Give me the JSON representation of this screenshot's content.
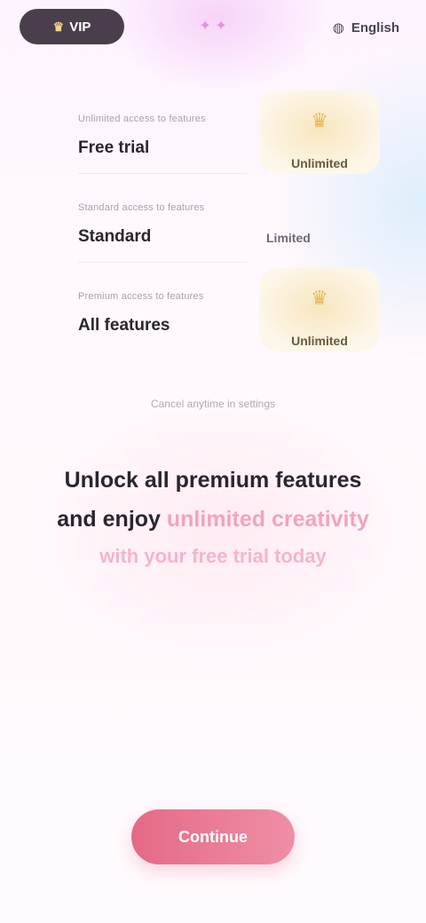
{
  "topbar": {
    "plan_label": "VIP",
    "plan_icon": "crown-icon",
    "center_label": "✦ ✦",
    "center_icon": "sparkle-icon",
    "right_label": "English",
    "right_icon": "globe-icon"
  },
  "compare": {
    "rows": [
      {
        "kicker": "Unlimited access to features",
        "label": "Free trial",
        "value": "Unlimited",
        "highlight": true
      },
      {
        "kicker": "Standard access to features",
        "label": "Standard",
        "value": "Limited",
        "highlight": false
      },
      {
        "kicker": "Premium access to features",
        "label": "All features",
        "value": "Unlimited",
        "highlight": true
      }
    ]
  },
  "footnote": "Cancel anytime in settings",
  "headline": {
    "line1": "Unlock all premium features",
    "line2_dark": "and enjoy",
    "line2_pink": "unlimited creativity",
    "line3": "with your free trial today"
  },
  "cta": {
    "label": "Continue"
  },
  "colors": {
    "accent_pink": "#e46a86",
    "gold": "#e9b94f",
    "pill_dark": "#4a3e4c"
  }
}
